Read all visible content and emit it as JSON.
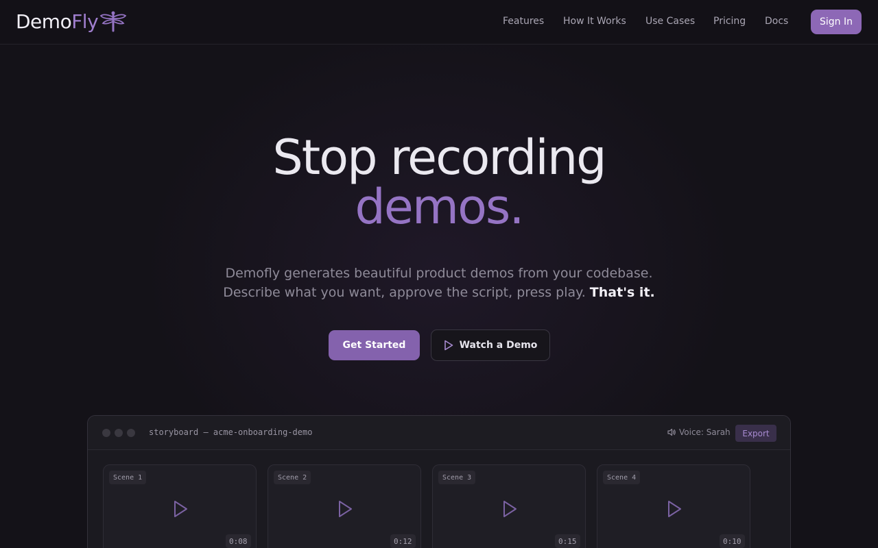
{
  "brand": {
    "name_part1": "Demo",
    "name_part2": "Fly",
    "icon": "dragonfly-icon",
    "accent": "#9574c4"
  },
  "nav": {
    "links": [
      "Features",
      "How It Works",
      "Use Cases",
      "Pricing",
      "Docs"
    ],
    "signin_label": "Sign In"
  },
  "hero": {
    "title_line1": "Stop recording",
    "title_line2": "demos.",
    "subtitle_line1": "Demofly generates beautiful product demos from your codebase.",
    "subtitle_line2": "Describe what you want, approve the script, press play.",
    "subtitle_emphasis": "That's it.",
    "primary_cta": "Get Started",
    "secondary_cta": "Watch a Demo",
    "secondary_icon": "play-icon"
  },
  "storyboard": {
    "title": "storyboard — acme-onboarding-demo",
    "voice_icon": "speaker-icon",
    "voice_label": "Voice: Sarah",
    "export_label": "Export",
    "scenes": [
      {
        "label": "Scene 1",
        "duration": "0:08"
      },
      {
        "label": "Scene 2",
        "duration": "0:12"
      },
      {
        "label": "Scene 3",
        "duration": "0:15"
      },
      {
        "label": "Scene 4",
        "duration": "0:10"
      }
    ]
  }
}
